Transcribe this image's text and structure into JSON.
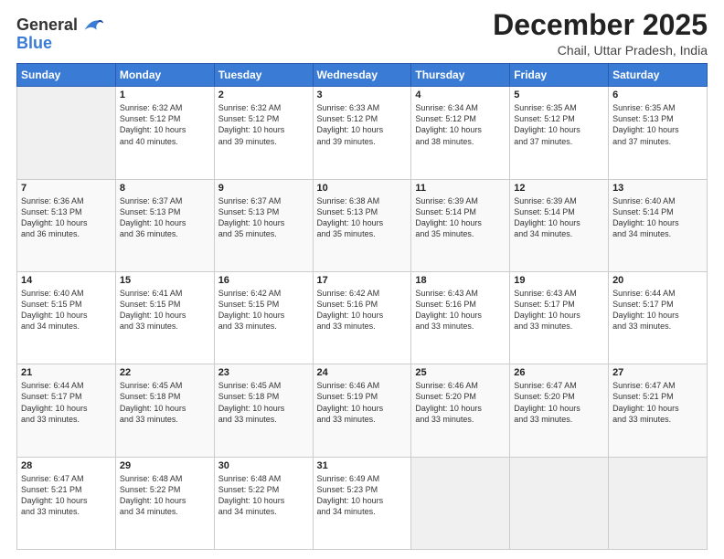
{
  "header": {
    "logo_line1": "General",
    "logo_line2": "Blue",
    "month_year": "December 2025",
    "location": "Chail, Uttar Pradesh, India"
  },
  "weekdays": [
    "Sunday",
    "Monday",
    "Tuesday",
    "Wednesday",
    "Thursday",
    "Friday",
    "Saturday"
  ],
  "weeks": [
    [
      {
        "day": "",
        "detail": ""
      },
      {
        "day": "1",
        "detail": "Sunrise: 6:32 AM\nSunset: 5:12 PM\nDaylight: 10 hours\nand 40 minutes."
      },
      {
        "day": "2",
        "detail": "Sunrise: 6:32 AM\nSunset: 5:12 PM\nDaylight: 10 hours\nand 39 minutes."
      },
      {
        "day": "3",
        "detail": "Sunrise: 6:33 AM\nSunset: 5:12 PM\nDaylight: 10 hours\nand 39 minutes."
      },
      {
        "day": "4",
        "detail": "Sunrise: 6:34 AM\nSunset: 5:12 PM\nDaylight: 10 hours\nand 38 minutes."
      },
      {
        "day": "5",
        "detail": "Sunrise: 6:35 AM\nSunset: 5:12 PM\nDaylight: 10 hours\nand 37 minutes."
      },
      {
        "day": "6",
        "detail": "Sunrise: 6:35 AM\nSunset: 5:13 PM\nDaylight: 10 hours\nand 37 minutes."
      }
    ],
    [
      {
        "day": "7",
        "detail": "Sunrise: 6:36 AM\nSunset: 5:13 PM\nDaylight: 10 hours\nand 36 minutes."
      },
      {
        "day": "8",
        "detail": "Sunrise: 6:37 AM\nSunset: 5:13 PM\nDaylight: 10 hours\nand 36 minutes."
      },
      {
        "day": "9",
        "detail": "Sunrise: 6:37 AM\nSunset: 5:13 PM\nDaylight: 10 hours\nand 35 minutes."
      },
      {
        "day": "10",
        "detail": "Sunrise: 6:38 AM\nSunset: 5:13 PM\nDaylight: 10 hours\nand 35 minutes."
      },
      {
        "day": "11",
        "detail": "Sunrise: 6:39 AM\nSunset: 5:14 PM\nDaylight: 10 hours\nand 35 minutes."
      },
      {
        "day": "12",
        "detail": "Sunrise: 6:39 AM\nSunset: 5:14 PM\nDaylight: 10 hours\nand 34 minutes."
      },
      {
        "day": "13",
        "detail": "Sunrise: 6:40 AM\nSunset: 5:14 PM\nDaylight: 10 hours\nand 34 minutes."
      }
    ],
    [
      {
        "day": "14",
        "detail": "Sunrise: 6:40 AM\nSunset: 5:15 PM\nDaylight: 10 hours\nand 34 minutes."
      },
      {
        "day": "15",
        "detail": "Sunrise: 6:41 AM\nSunset: 5:15 PM\nDaylight: 10 hours\nand 33 minutes."
      },
      {
        "day": "16",
        "detail": "Sunrise: 6:42 AM\nSunset: 5:15 PM\nDaylight: 10 hours\nand 33 minutes."
      },
      {
        "day": "17",
        "detail": "Sunrise: 6:42 AM\nSunset: 5:16 PM\nDaylight: 10 hours\nand 33 minutes."
      },
      {
        "day": "18",
        "detail": "Sunrise: 6:43 AM\nSunset: 5:16 PM\nDaylight: 10 hours\nand 33 minutes."
      },
      {
        "day": "19",
        "detail": "Sunrise: 6:43 AM\nSunset: 5:17 PM\nDaylight: 10 hours\nand 33 minutes."
      },
      {
        "day": "20",
        "detail": "Sunrise: 6:44 AM\nSunset: 5:17 PM\nDaylight: 10 hours\nand 33 minutes."
      }
    ],
    [
      {
        "day": "21",
        "detail": "Sunrise: 6:44 AM\nSunset: 5:17 PM\nDaylight: 10 hours\nand 33 minutes."
      },
      {
        "day": "22",
        "detail": "Sunrise: 6:45 AM\nSunset: 5:18 PM\nDaylight: 10 hours\nand 33 minutes."
      },
      {
        "day": "23",
        "detail": "Sunrise: 6:45 AM\nSunset: 5:18 PM\nDaylight: 10 hours\nand 33 minutes."
      },
      {
        "day": "24",
        "detail": "Sunrise: 6:46 AM\nSunset: 5:19 PM\nDaylight: 10 hours\nand 33 minutes."
      },
      {
        "day": "25",
        "detail": "Sunrise: 6:46 AM\nSunset: 5:20 PM\nDaylight: 10 hours\nand 33 minutes."
      },
      {
        "day": "26",
        "detail": "Sunrise: 6:47 AM\nSunset: 5:20 PM\nDaylight: 10 hours\nand 33 minutes."
      },
      {
        "day": "27",
        "detail": "Sunrise: 6:47 AM\nSunset: 5:21 PM\nDaylight: 10 hours\nand 33 minutes."
      }
    ],
    [
      {
        "day": "28",
        "detail": "Sunrise: 6:47 AM\nSunset: 5:21 PM\nDaylight: 10 hours\nand 33 minutes."
      },
      {
        "day": "29",
        "detail": "Sunrise: 6:48 AM\nSunset: 5:22 PM\nDaylight: 10 hours\nand 34 minutes."
      },
      {
        "day": "30",
        "detail": "Sunrise: 6:48 AM\nSunset: 5:22 PM\nDaylight: 10 hours\nand 34 minutes."
      },
      {
        "day": "31",
        "detail": "Sunrise: 6:49 AM\nSunset: 5:23 PM\nDaylight: 10 hours\nand 34 minutes."
      },
      {
        "day": "",
        "detail": ""
      },
      {
        "day": "",
        "detail": ""
      },
      {
        "day": "",
        "detail": ""
      }
    ]
  ]
}
